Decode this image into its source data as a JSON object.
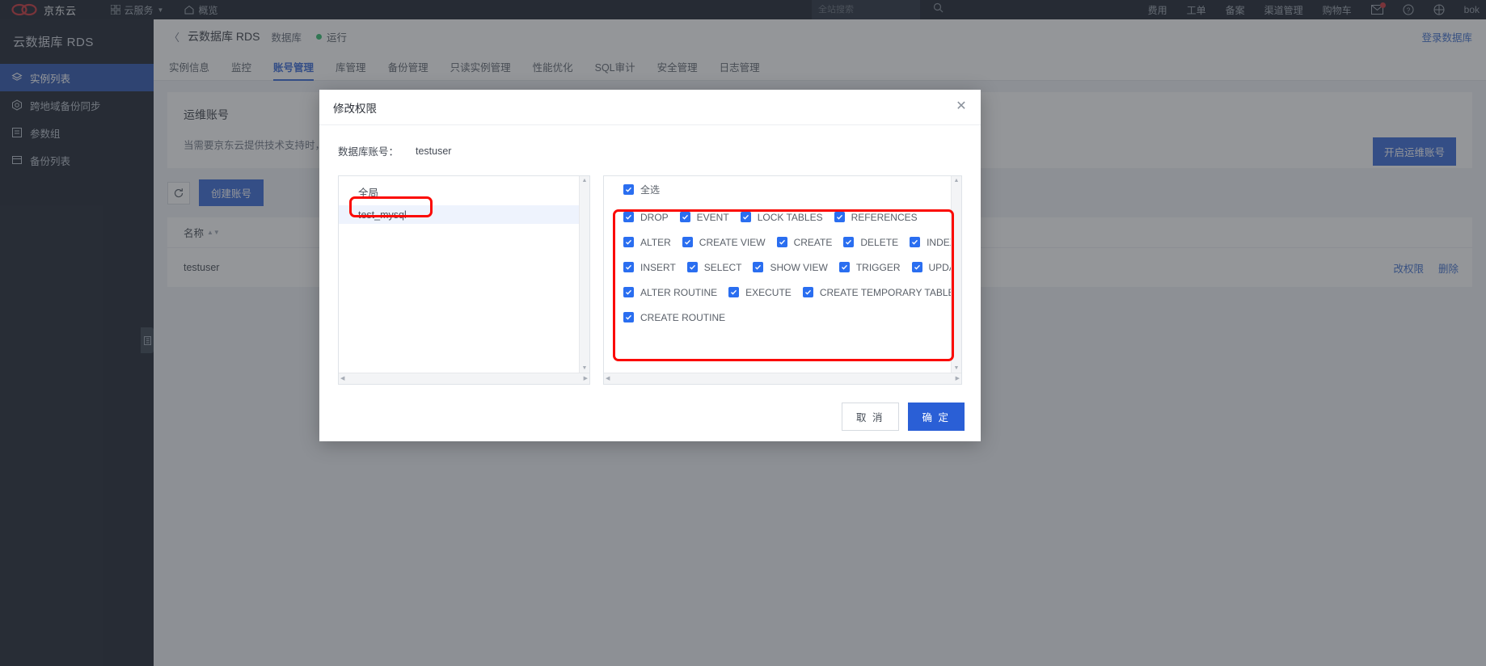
{
  "header": {
    "logo_text": "京东云",
    "nav": [
      {
        "label": "云服务",
        "icon": "grid-icon",
        "caret": true
      },
      {
        "label": "概览",
        "icon": "home-icon",
        "caret": false
      }
    ],
    "search_placeholder": "全站搜索",
    "right_links": [
      "费用",
      "工单",
      "备案",
      "渠道管理",
      "购物车"
    ],
    "icons": [
      "mail-icon",
      "help-icon",
      "globe-icon"
    ],
    "username": "bok"
  },
  "sidebar": {
    "title": "云数据库 RDS",
    "items": [
      {
        "label": "实例列表",
        "icon": "layers-icon",
        "active": true
      },
      {
        "label": "跨地域备份同步",
        "icon": "sync-icon",
        "active": false
      },
      {
        "label": "参数组",
        "icon": "params-icon",
        "active": false
      },
      {
        "label": "备份列表",
        "icon": "backup-icon",
        "active": false
      }
    ]
  },
  "breadcrumb": {
    "back": "〈",
    "main": "云数据库 RDS",
    "sub": "数据库",
    "status": "运行",
    "status_color": "#25b864",
    "login_link": "登录数据库"
  },
  "tabs": [
    {
      "label": "实例信息",
      "active": false
    },
    {
      "label": "监控",
      "active": false
    },
    {
      "label": "账号管理",
      "active": true
    },
    {
      "label": "库管理",
      "active": false
    },
    {
      "label": "备份管理",
      "active": false
    },
    {
      "label": "只读实例管理",
      "active": false
    },
    {
      "label": "性能优化",
      "active": false
    },
    {
      "label": "SQL审计",
      "active": false
    },
    {
      "label": "安全管理",
      "active": false
    },
    {
      "label": "日志管理",
      "active": false
    }
  ],
  "ops_panel": {
    "title": "运维账号",
    "desc": "当需要京东云提供技术支持时，您",
    "button": "开启运维账号"
  },
  "toolbar": {
    "refresh_icon": "refresh-icon",
    "create_label": "创建账号"
  },
  "table": {
    "columns": [
      "名称"
    ],
    "rows": [
      {
        "name": "testuser",
        "actions": [
          "改权限",
          "删除"
        ]
      }
    ]
  },
  "modal": {
    "title": "修改权限",
    "close_icon": "close-icon",
    "account_label": "数据库账号：",
    "account_value": "testuser",
    "left_pane": {
      "header": "全局",
      "items": [
        {
          "label": "test_mysql",
          "selected": true
        }
      ]
    },
    "right_pane": {
      "select_all_label": "全选",
      "select_all_checked": true,
      "permission_rows": [
        [
          "DROP",
          "EVENT",
          "LOCK TABLES",
          "REFERENCES"
        ],
        [
          "ALTER",
          "CREATE VIEW",
          "CREATE",
          "DELETE",
          "INDEX"
        ],
        [
          "INSERT",
          "SELECT",
          "SHOW VIEW",
          "TRIGGER",
          "UPDATE"
        ],
        [
          "ALTER ROUTINE",
          "EXECUTE",
          "CREATE TEMPORARY TABLES"
        ],
        [
          "CREATE ROUTINE"
        ]
      ]
    },
    "footer": {
      "cancel": "取 消",
      "confirm": "确 定"
    }
  },
  "colors": {
    "accent": "#2a5fd6",
    "checkbox": "#2a6ef0",
    "annotation": "#fb0a04",
    "status_ok": "#25b864"
  }
}
